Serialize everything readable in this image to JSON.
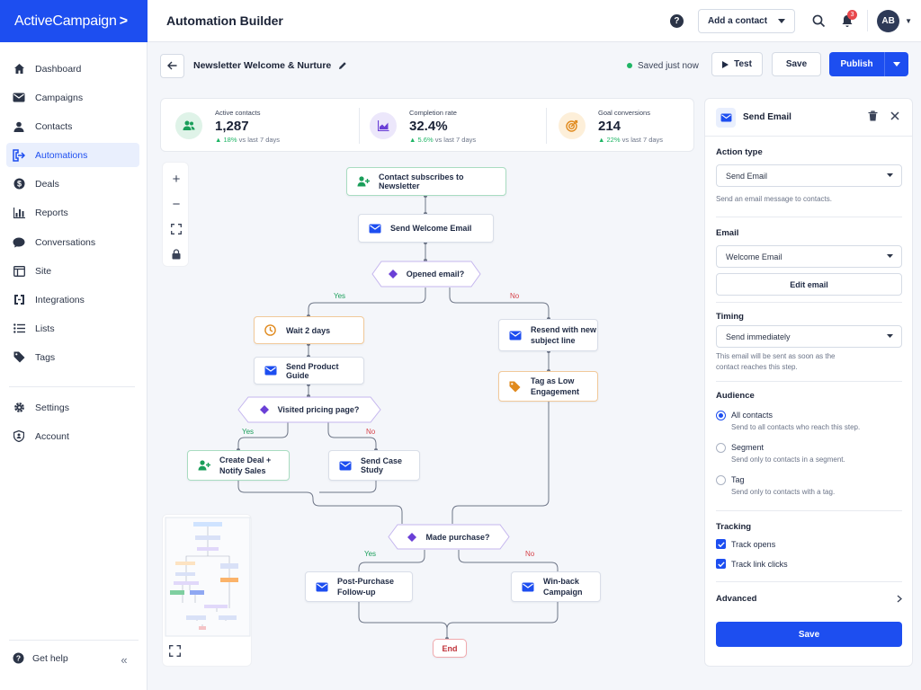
{
  "brand": {
    "logo_text": "ActiveCampaign",
    "logo_suffix": ">",
    "primary_color": "#1d4ef0"
  },
  "topbar": {
    "title": "Automation Builder",
    "add_contact": "Add a contact",
    "notif_count": "3",
    "avatar_initials": "AB"
  },
  "sidebar": {
    "items": [
      {
        "label": "Dashboard",
        "icon": "home-icon"
      },
      {
        "label": "Campaigns",
        "icon": "mail-icon"
      },
      {
        "label": "Contacts",
        "icon": "person-icon"
      },
      {
        "label": "Automations",
        "icon": "automation-icon"
      },
      {
        "label": "Deals",
        "icon": "dollar-icon"
      },
      {
        "label": "Reports",
        "icon": "bar-chart-icon"
      },
      {
        "label": "Conversations",
        "icon": "chat-icon"
      },
      {
        "label": "Site",
        "icon": "browser-icon"
      },
      {
        "label": "Integrations",
        "icon": "plug-icon"
      },
      {
        "label": "Lists",
        "icon": "list-icon"
      },
      {
        "label": "Tags",
        "icon": "tag-icon"
      },
      {
        "label": "Settings",
        "icon": "gear-icon"
      },
      {
        "label": "Account",
        "icon": "shield-icon"
      }
    ],
    "get_help": "Get help"
  },
  "automation": {
    "name": "Newsletter Welcome & Nurture",
    "status": "Saved just now",
    "test": "Test",
    "save": "Save",
    "publish": "Publish"
  },
  "stats": [
    {
      "label": "Active contacts",
      "value": "1,287",
      "change": "18%",
      "suffix": "vs last 7 days"
    },
    {
      "label": "Completion rate",
      "value": "32.4%",
      "change": "5.6%",
      "suffix": "vs last 7 days"
    },
    {
      "label": "Goal conversions",
      "value": "214",
      "change": "22%",
      "suffix": "vs last 7 days"
    }
  ],
  "flow": {
    "trigger": "Contact subscribes to Newsletter",
    "send_welcome": "Send Welcome Email",
    "opened": "Opened email?",
    "wait": "Wait 2 days",
    "resend_1": "Resend with new",
    "resend_2": "subject line",
    "product_guide": "Send Product Guide",
    "tag_low_1": "Tag as Low",
    "tag_low_2": "Engagement",
    "visited": "Visited pricing page?",
    "deal_1": "Create Deal +",
    "deal_2": "Notify Sales",
    "case_study": "Send Case Study",
    "made_purchase": "Made purchase?",
    "post_1": "Post-Purchase",
    "post_2": "Follow-up",
    "winback_1": "Win-back",
    "winback_2": "Campaign",
    "end": "End",
    "yes": "Yes",
    "no": "No"
  },
  "panel": {
    "title": "Send Email",
    "action_type_label": "Action type",
    "action_type_value": "Send Email",
    "action_type_hint": "Send an email message to contacts.",
    "email_label": "Email",
    "email_value": "Welcome Email",
    "edit_email": "Edit email",
    "timing_label": "Timing",
    "timing_value": "Send immediately",
    "timing_hint_1": "This email will be sent as soon as the",
    "timing_hint_2": "contact reaches this step.",
    "audience_label": "Audience",
    "audience_options": [
      {
        "label": "All contacts",
        "sub": "Send to all contacts who reach this step.",
        "selected": true
      },
      {
        "label": "Segment",
        "sub": "Send only to contacts in a segment.",
        "selected": false
      },
      {
        "label": "Tag",
        "sub": "Send only to contacts with a tag.",
        "selected": false
      }
    ],
    "tracking_label": "Tracking",
    "track_opens": "Track opens",
    "track_clicks": "Track link clicks",
    "advanced": "Advanced",
    "save": "Save"
  }
}
